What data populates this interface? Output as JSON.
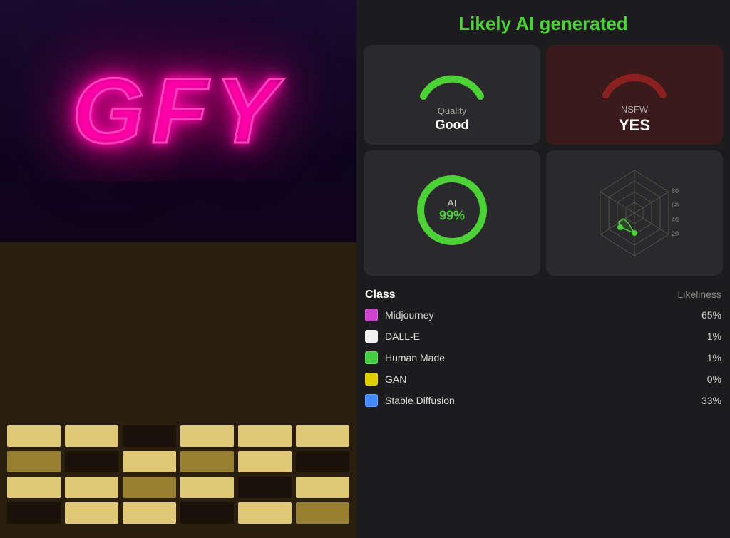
{
  "header": {
    "title": "Likely AI generated",
    "title_color": "#4cd137"
  },
  "metrics": {
    "quality": {
      "label": "Quality",
      "value": "Good",
      "gauge_percent": 72,
      "color": "#4cd137"
    },
    "nsfw": {
      "label": "NSFW",
      "value": "YES",
      "gauge_percent": 85,
      "color": "#8b1a1a"
    },
    "ai": {
      "label": "AI",
      "percent": "99%",
      "value": 99,
      "color": "#4cd137"
    },
    "radar": {
      "labels": [
        "80",
        "60",
        "40",
        "20"
      ]
    }
  },
  "class_table": {
    "column_class": "Class",
    "column_likeliness": "Likeliness",
    "rows": [
      {
        "name": "Midjourney",
        "percent": "65%",
        "color": "#cc44cc"
      },
      {
        "name": "DALL-E",
        "percent": "1%",
        "color": "#f0f0f0"
      },
      {
        "name": "Human Made",
        "percent": "1%",
        "color": "#44cc44"
      },
      {
        "name": "GAN",
        "percent": "0%",
        "color": "#ddcc00"
      },
      {
        "name": "Stable Diffusion",
        "percent": "33%",
        "color": "#4488ff"
      }
    ]
  },
  "image": {
    "text": "GFY",
    "alt": "Building with neon GFY sign"
  }
}
